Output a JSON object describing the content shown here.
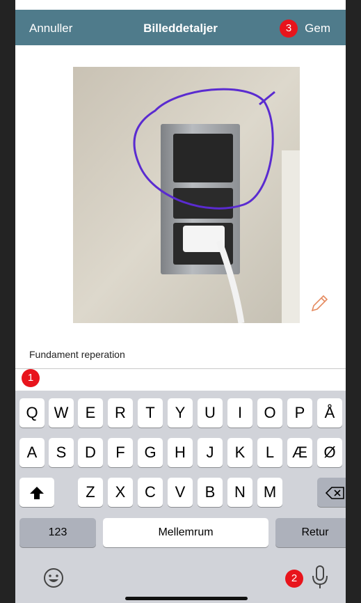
{
  "navbar": {
    "cancel": "Annuller",
    "title": "Billeddetaljer",
    "save": "Gem",
    "bg_color": "#4f7b8b"
  },
  "badges": {
    "save": "3",
    "input": "1",
    "mic": "2",
    "color": "#e8141c"
  },
  "photo": {
    "subject": "wall socket with purple circle drawn around top switch",
    "edit_icon": "pencil-icon"
  },
  "caption": "Fundament reperation",
  "input": {
    "value": ""
  },
  "keyboard": {
    "row1": [
      "Q",
      "W",
      "E",
      "R",
      "T",
      "Y",
      "U",
      "I",
      "O",
      "P",
      "Å"
    ],
    "row2": [
      "A",
      "S",
      "D",
      "F",
      "G",
      "H",
      "J",
      "K",
      "L",
      "Æ",
      "Ø"
    ],
    "row3": [
      "Z",
      "X",
      "C",
      "V",
      "B",
      "N",
      "M"
    ],
    "numbers": "123",
    "space": "Mellemrum",
    "return": "Retur",
    "shift_icon": "shift-icon",
    "backspace_icon": "backspace-icon",
    "emoji_icon": "emoji-icon",
    "mic_icon": "microphone-icon"
  }
}
